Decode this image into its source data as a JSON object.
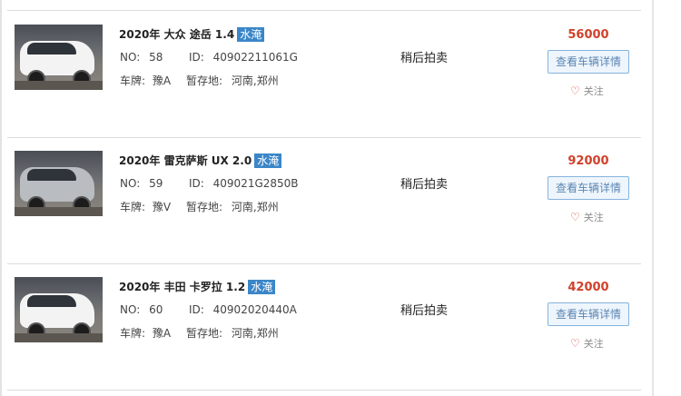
{
  "listings": [
    {
      "title": "2020年 大众 途岳 1.4",
      "tag": "水淹",
      "no_label": "NO:",
      "no": "58",
      "id_label": "ID:",
      "id": "40902211061G",
      "plate_label": "车牌:",
      "plate": "豫A",
      "location_label": "暂存地:",
      "location": "河南,郑州",
      "status": "稍后拍卖",
      "price": "56000",
      "detail_button": "查看车辆详情",
      "follow": "关注",
      "thumb_color": "white"
    },
    {
      "title": "2020年 雷克萨斯 UX 2.0",
      "tag": "水淹",
      "no_label": "NO:",
      "no": "59",
      "id_label": "ID:",
      "id": "409021G2850B",
      "plate_label": "车牌:",
      "plate": "豫V",
      "location_label": "暂存地:",
      "location": "河南,郑州",
      "status": "稍后拍卖",
      "price": "92000",
      "detail_button": "查看车辆详情",
      "follow": "关注",
      "thumb_color": "gray"
    },
    {
      "title": "2020年 丰田 卡罗拉 1.2",
      "tag": "水淹",
      "no_label": "NO:",
      "no": "60",
      "id_label": "ID:",
      "id": "40902020440A",
      "plate_label": "车牌:",
      "plate": "豫A",
      "location_label": "暂存地:",
      "location": "河南,郑州",
      "status": "稍后拍卖",
      "price": "42000",
      "detail_button": "查看车辆详情",
      "follow": "关注",
      "thumb_color": "white"
    }
  ],
  "colors": {
    "price": "#d0412b",
    "tag_bg": "#3b86c8",
    "button_border": "#86b3dc",
    "button_text": "#5b86b4"
  },
  "icons": {
    "follow": "heart-icon"
  }
}
